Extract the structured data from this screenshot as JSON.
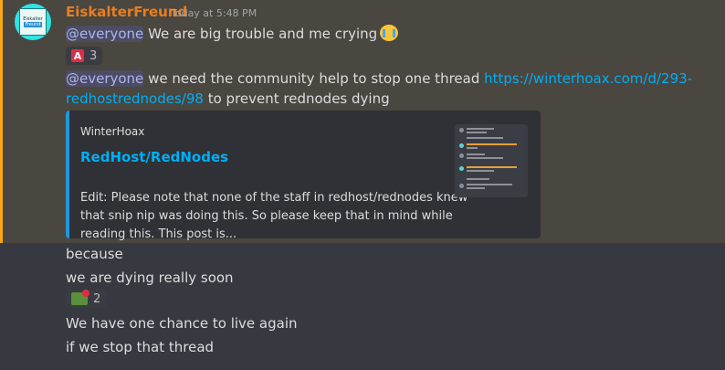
{
  "message": {
    "author": "EiskalterFreund",
    "timestamp": "Today at 5:48 PM",
    "avatar": {
      "lines": [
        "Eiskalter",
        "Freund"
      ],
      "color": "#2ee5e5"
    },
    "line1": {
      "mention": "@everyone",
      "text": " We are big trouble and me crying",
      "emoji": "loudly-crying-face"
    },
    "reaction1": {
      "icon": "a-button-icon",
      "glyph": "A",
      "count": "3"
    },
    "line2": {
      "mention": "@everyone",
      "text_before": " we need the community help to stop one thread ",
      "link_part1": "https://winterhoax.com/d/293-",
      "link_part2": "redhostrednodes/98",
      "text_after": " to prevent rednodes dying"
    },
    "embed": {
      "provider": "WinterHoax",
      "title": "RedHost/RedNodes",
      "description_lines": [
        "Edit: Please note that none of the staff in redhost/rednodes knew",
        "that snip nip was doing this. So please keep that in mind while",
        "reading this. This post is..."
      ],
      "accent_color": "#2196d9"
    },
    "followups": [
      "because",
      "we are dying really soon"
    ],
    "reaction2": {
      "icon": "sos-icon",
      "count": "2"
    },
    "followups2": [
      "We have one chance to live again",
      "if we stop that thread"
    ]
  },
  "colors": {
    "background": "#36393f",
    "highlight": "#4a4640",
    "highlight_bar": "#faa61a",
    "username": "#e67e22",
    "link": "#00aff4"
  }
}
